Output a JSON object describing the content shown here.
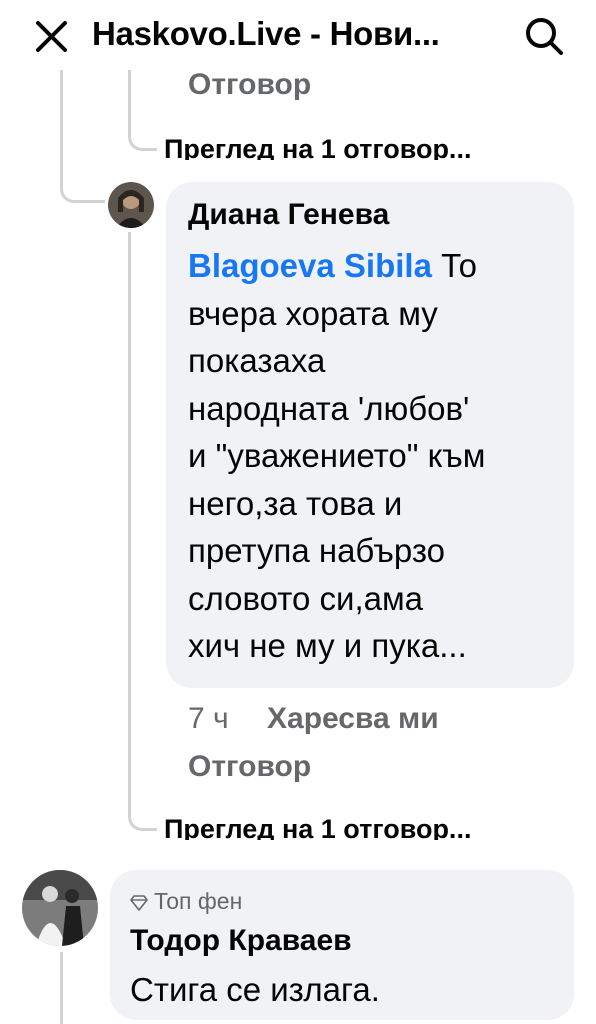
{
  "header": {
    "title": "Haskovo.Live - Нови...",
    "close_icon": "close-icon",
    "search_icon": "search-icon"
  },
  "thread": {
    "prev_reply": {
      "reply_label": "Отговор",
      "view_replies": "Преглед на 1 отговор..."
    },
    "comment_1": {
      "author": "Диана Генева",
      "mention": "Blagoeva Sibila",
      "text_lines": [
        " То",
        "вчера хората му",
        "показаха",
        "народната 'любов'",
        "и \"уважението\" към",
        "него,за това и",
        "претупа набързо",
        "словото  си,ама",
        "хич не му и пука..."
      ],
      "time": "7 ч",
      "like_label": "Харесва ми",
      "reply_label": "Отговор",
      "view_replies": "Преглед на 1 отговор..."
    },
    "comment_2": {
      "badge": "Топ фен",
      "badge_icon": "diamond-icon",
      "author": "Тодор Краваев",
      "text": "Стига се излага."
    }
  },
  "colors": {
    "accent": "#1877f2",
    "bubble": "#f0f2f5",
    "muted": "#65676b",
    "thread_line": "#d0d2d6"
  }
}
